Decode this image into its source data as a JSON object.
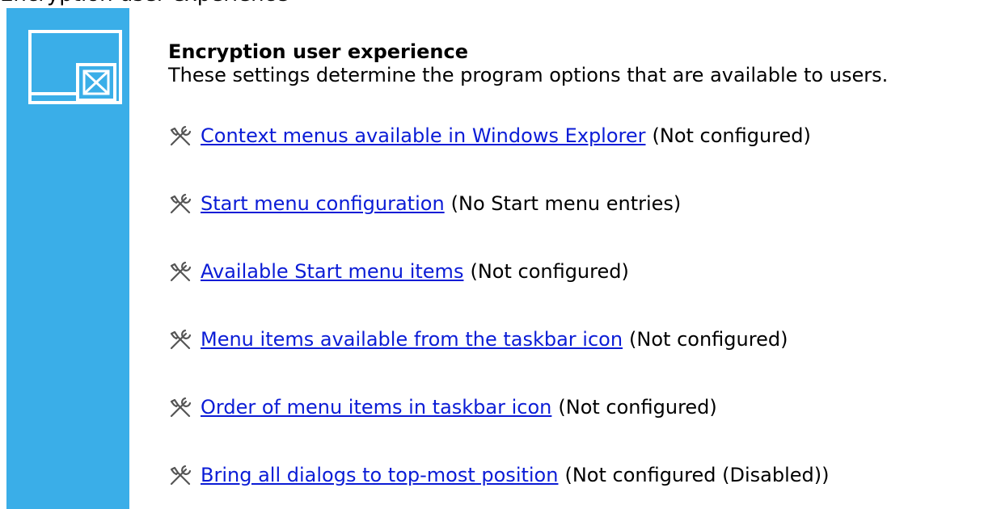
{
  "top_cut_text": "Encryption user experience",
  "section": {
    "heading": "Encryption user experience",
    "description": "These settings determine the program options that are available to users."
  },
  "settings": [
    {
      "label": "Context menus available in Windows Explorer",
      "status": "(Not configured)"
    },
    {
      "label": "Start menu configuration",
      "status": "(No Start menu entries)"
    },
    {
      "label": "Available Start menu items",
      "status": "(Not configured)"
    },
    {
      "label": "Menu items available from the taskbar icon",
      "status": "(Not configured)"
    },
    {
      "label": "Order of menu items in taskbar icon",
      "status": "(Not configured)"
    },
    {
      "label": "Bring all dialogs to top-most position",
      "status": "(Not configured (Disabled))"
    }
  ],
  "icons": {
    "panel": "window-with-crossed-box-icon",
    "setting": "tools-icon"
  },
  "colors": {
    "side_panel": "#3aaee8",
    "link": "#0b1cd6"
  }
}
